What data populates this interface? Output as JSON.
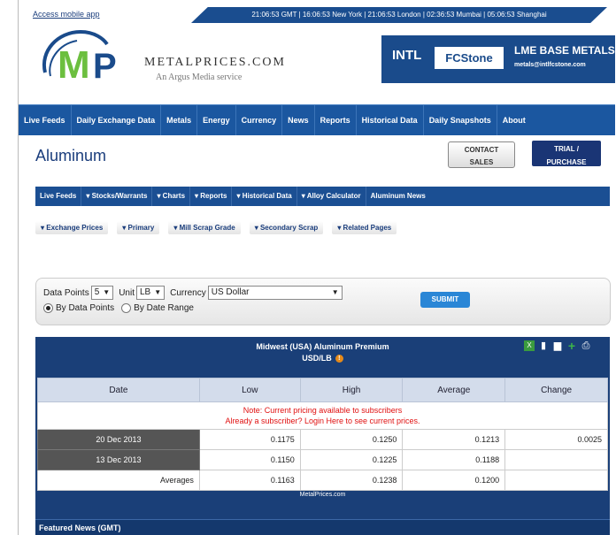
{
  "topbar": {
    "mobile_link": "Access mobile app",
    "times": "21:06:53 GMT | 16:06:53 New York | 21:06:53 London | 02:36:53 Mumbai | 05:06:53 Shanghai"
  },
  "logo": {
    "name": "METALPRICES.COM",
    "tagline": "An Argus Media service"
  },
  "ad": {
    "brand_intl": "INTL",
    "brand_fcstone": "FCStone",
    "title": "LME BASE METALS",
    "email": "metals@intlfcstone.com"
  },
  "main_nav": [
    "Live Feeds",
    "Daily Exchange Data",
    "Metals",
    "Energy",
    "Currency",
    "News",
    "Reports",
    "Historical Data",
    "Daily Snapshots",
    "About"
  ],
  "page": {
    "title": "Aluminum",
    "contact_line1": "CONTACT",
    "contact_line2": "SALES",
    "trial_line1": "TRIAL /",
    "trial_line2": "PURCHASE"
  },
  "sub_nav": [
    "Live Feeds",
    "▾ Stocks/Warrants",
    "▾ Charts",
    "▾ Reports",
    "▾ Historical Data",
    "▾ Alloy Calculator",
    "Aluminum News"
  ],
  "pills": [
    "▾ Exchange Prices",
    "▾ Primary",
    "▾ Mill Scrap Grade",
    "▾ Secondary Scrap",
    "▾ Related Pages"
  ],
  "form": {
    "data_points_label": "Data Points",
    "data_points_value": "5",
    "unit_label": "Unit",
    "unit_value": "LB",
    "currency_label": "Currency",
    "currency_value": "US Dollar",
    "radio_points": "By Data Points",
    "radio_range": "By Date Range",
    "submit": "SUBMIT"
  },
  "table": {
    "title": "Midwest (USA) Aluminum Premium",
    "unit": "USD/LB",
    "columns": [
      "Date",
      "Low",
      "High",
      "Average",
      "Change"
    ],
    "note_line1": "Note: Current pricing available to subscribers",
    "note_line2": "Already a subscriber? Login Here to see current prices.",
    "rows": [
      {
        "date": "20 Dec 2013",
        "low": "0.1175",
        "high": "0.1250",
        "average": "0.1213",
        "change": "0.0025"
      },
      {
        "date": "13 Dec 2013",
        "low": "0.1150",
        "high": "0.1225",
        "average": "0.1188",
        "change": ""
      }
    ],
    "averages_label": "Averages",
    "averages": {
      "low": "0.1163",
      "high": "0.1238",
      "average": "0.1200"
    },
    "footer": "MetalPrices.com"
  },
  "featured": {
    "label": "Featured News (GMT)"
  },
  "colors": {
    "nav_blue": "#1b57a0",
    "dark_blue": "#1a3f78",
    "alert_red": "#e01010",
    "accent_green": "#3cb34a"
  },
  "icons": [
    "excel-icon",
    "trash-icon",
    "chart-icon",
    "add-icon",
    "print-icon"
  ]
}
